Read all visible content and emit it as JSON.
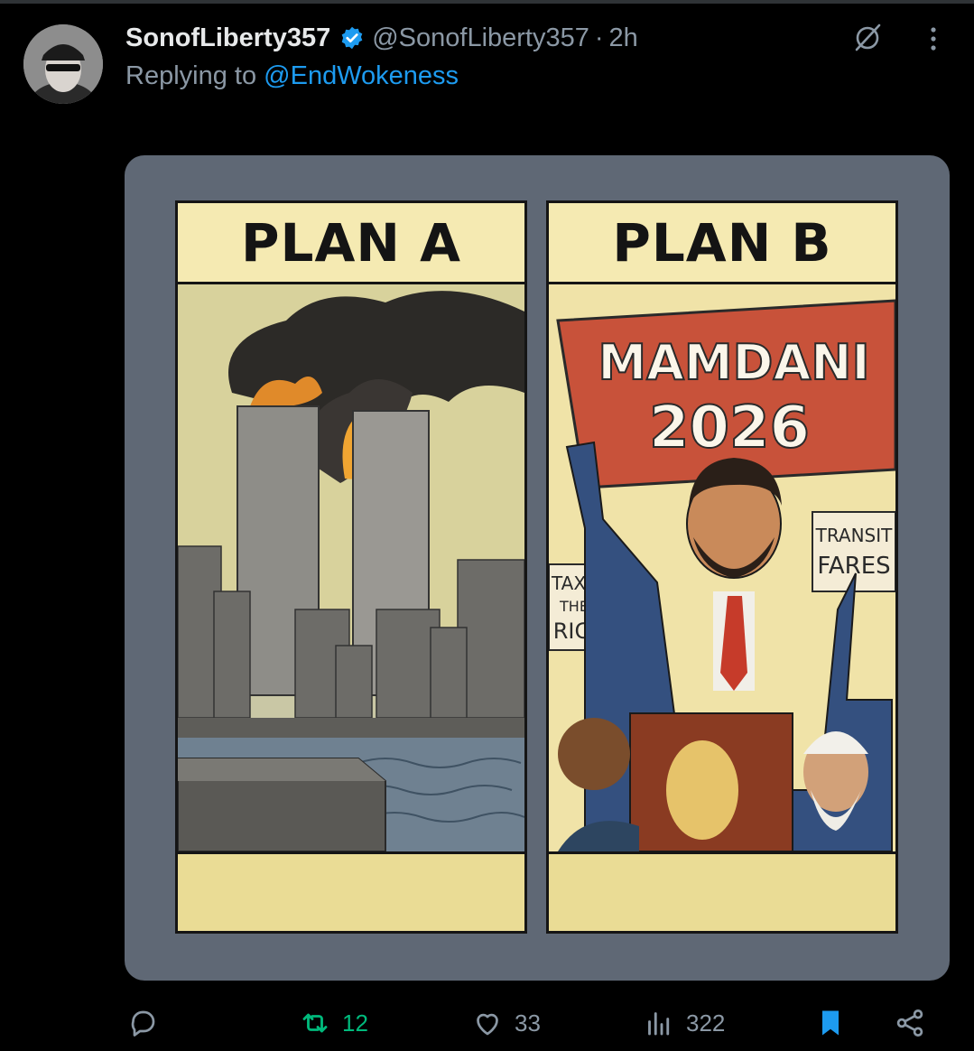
{
  "post": {
    "display_name": "SonofLiberty357",
    "handle": "@SonofLiberty357",
    "separator": "·",
    "time": "2h",
    "replying_prefix": "Replying to",
    "replying_to": "@EndWokeness"
  },
  "media": {
    "panels": [
      {
        "title": "PLAN A"
      },
      {
        "title": "PLAN B",
        "banner_line1": "MAMDANI",
        "banner_line2": "2026",
        "sign_left": [
          "TAX",
          "THE",
          "RICH"
        ],
        "sign_right": [
          "TRANSIT",
          "FARES"
        ]
      }
    ]
  },
  "actions": {
    "reply_count": "",
    "retweet_count": "12",
    "like_count": "33",
    "views_count": "322",
    "bookmarked": true
  },
  "icons": [
    "verified-badge-icon",
    "grok-icon",
    "more-icon",
    "reply-icon",
    "retweet-icon",
    "like-icon",
    "views-icon",
    "bookmark-icon",
    "share-icon"
  ],
  "colors": {
    "background": "#000000",
    "accent": "#1d9bf0",
    "retweet": "#00ba7c",
    "muted": "#8b98a5",
    "text": "#e7e9ea"
  }
}
